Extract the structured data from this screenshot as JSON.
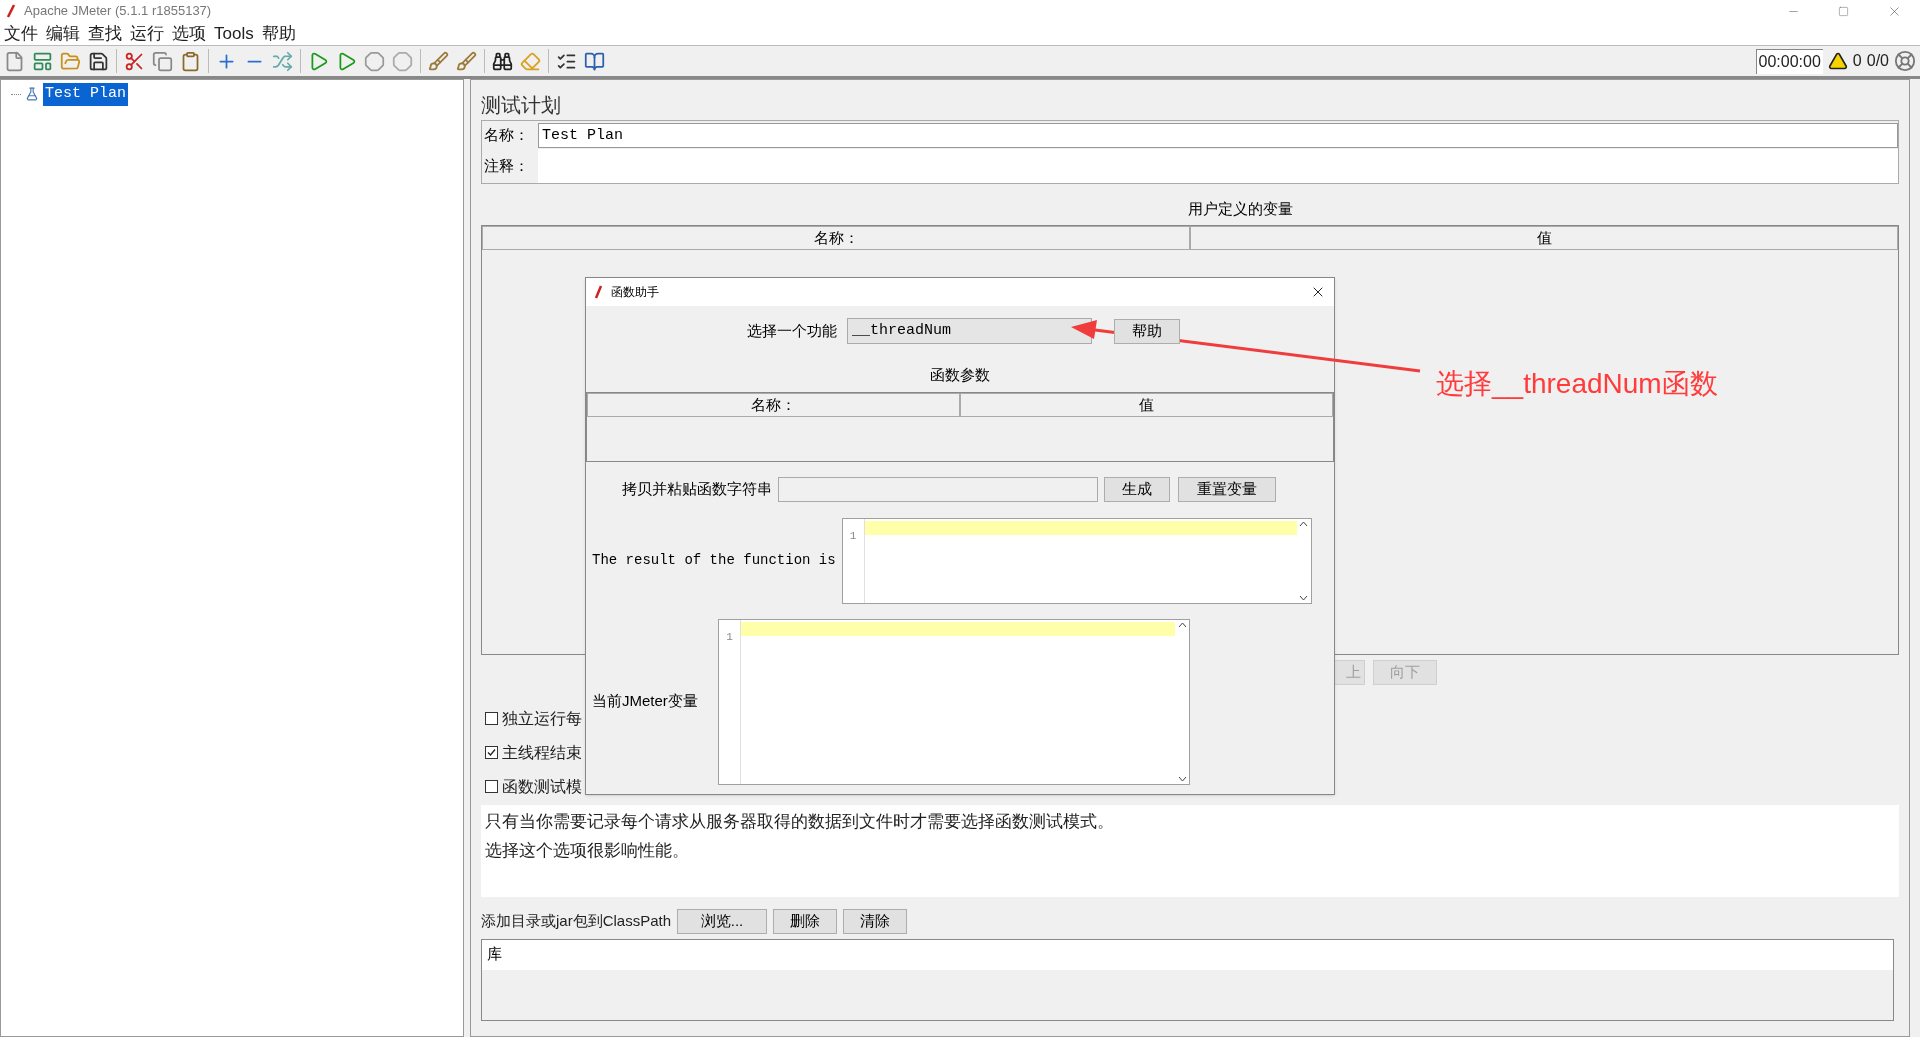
{
  "window": {
    "title": "Apache JMeter (5.1.1 r1855137)"
  },
  "menu": [
    "文件",
    "编辑",
    "查找",
    "运行",
    "选项",
    "Tools",
    "帮助"
  ],
  "toolbar": {
    "timer": "00:00:00",
    "warnings": "0",
    "threads": "0/0"
  },
  "tree": [
    {
      "label": "Test Plan",
      "selected": true
    }
  ],
  "test_plan": {
    "title": "测试计划",
    "name_label": "名称：",
    "name_value": "Test Plan",
    "comment_label": "注释：",
    "variables": {
      "title": "用户定义的变量",
      "columns": [
        "名称：",
        "值"
      ]
    },
    "move_buttons": [
      {
        "label": "上",
        "disabled": true
      },
      {
        "label": "向下",
        "disabled": true
      }
    ],
    "options": [
      {
        "label": "独立运行每",
        "checked": false
      },
      {
        "label": "主线程结束",
        "checked": true
      },
      {
        "label": "函数测试模",
        "checked": false
      }
    ],
    "note": [
      "只有当你需要记录每个请求从服务器取得的数据到文件时才需要选择函数测试模式。",
      "选择这个选项很影响性能。"
    ],
    "classpath": {
      "label": "添加目录或jar包到ClassPath",
      "buttons": [
        "浏览...",
        "删除",
        "清除"
      ],
      "library_header": "库"
    }
  },
  "dialog": {
    "title": "函数助手",
    "function_label": "选择一个功能",
    "function_value": "__threadNum",
    "help_button": "帮助",
    "params_title": "函数参数",
    "columns": [
      "名称：",
      "值"
    ],
    "copy_label": "拷贝并粘贴函数字符串",
    "buttons": [
      "生成",
      "重置变量"
    ],
    "result_label": "The result of the function is",
    "result_line": "1",
    "vars_label": "当前JMeter变量",
    "vars_line": "1"
  },
  "annotation": {
    "text": "选择__threadNum函数"
  }
}
